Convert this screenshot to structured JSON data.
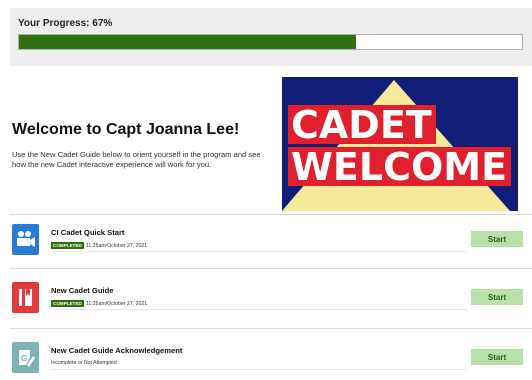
{
  "progress": {
    "label": "Your Progress: 67%",
    "fraction": 0.67,
    "fill_color": "#2f6f0c"
  },
  "welcome": {
    "title": "Welcome to Capt Joanna Lee!",
    "body": "Use the New Cadet Guide below to orient yourself in the program and see how the new Cadet interactive experience will work for you."
  },
  "banner": {
    "line1": "CADET",
    "line2": "WELCOME",
    "colors": {
      "background": "#101e78",
      "triangle": "#f6e99a",
      "word_bg": "#e0202d"
    }
  },
  "courses": [
    {
      "title": "CI Cadet Quick Start",
      "badge": "COMPLETED",
      "status_text": "11:25am/October 27, 2021",
      "icon": "video-camera-icon",
      "icon_color": "#2a7bd5",
      "button": "Start"
    },
    {
      "title": "New Cadet Guide",
      "badge": "COMPLETED",
      "status_text": "11:25am/October 27, 2021",
      "icon": "book-icon",
      "icon_color": "#e33b3b",
      "button": "Start"
    },
    {
      "title": "New Cadet Guide Acknowledgement",
      "badge": "",
      "status_text": "Incomplete or Not Attempted",
      "icon": "document-edit-icon",
      "icon_color": "#7fb3b3",
      "button": "Start"
    }
  ]
}
